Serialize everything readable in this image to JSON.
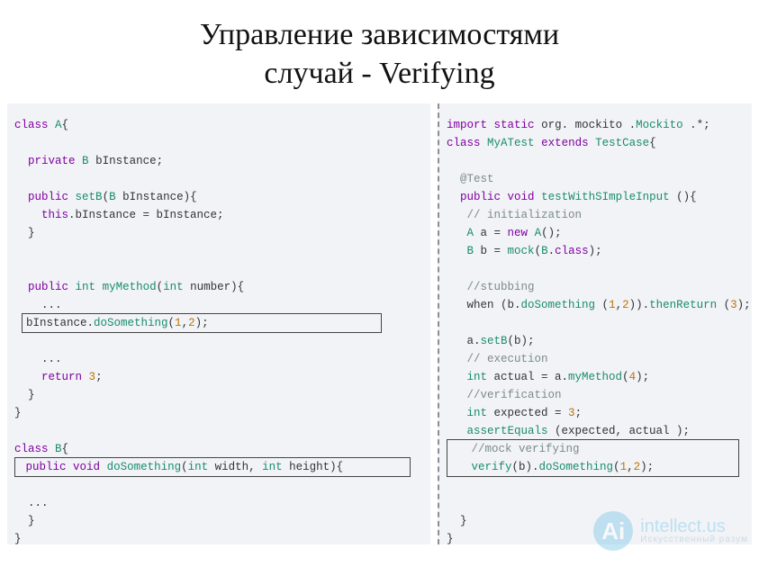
{
  "title_line1": "Управление зависимостями",
  "title_line2": "случай - Verifying",
  "left": {
    "l1_kw": "class",
    "l1_sp": " ",
    "l1_typ": "A",
    "l1_brace": "{",
    "l3_kw": "private",
    "l3_sp": " ",
    "l3_typ": "B",
    "l3_rest": " bInstance;",
    "l5_kw": "public",
    "l5_sp": " ",
    "l5_mth": "setB",
    "l5_open": "(",
    "l5_typ": "B",
    "l5_rest": " bInstance){",
    "l6_kw": "this",
    "l6_rest": ".bInstance = bInstance;",
    "l7": "}",
    "l10_kw": "public",
    "l10_sp": " ",
    "l10_typ": "int",
    "l10_sp2": " ",
    "l10_mth": "myMethod",
    "l10_open": "(",
    "l10_typ2": "int",
    "l10_rest": " number){",
    "l11": "...",
    "box1_a": "bInstance.",
    "box1_mth": "doSomething",
    "box1_open": "(",
    "box1_n1": "1",
    "box1_c": ",",
    "box1_n2": "2",
    "box1_close": ");",
    "l13": "...",
    "l14_kw": "return",
    "l14_sp": " ",
    "l14_n": "3",
    "l14_semi": ";",
    "l15": "}",
    "l16": "}",
    "l18_kw": "class",
    "l18_sp": " ",
    "l18_typ": "B",
    "l18_brace": "{",
    "box2_kw": "public",
    "box2_sp": " ",
    "box2_kw2": "void",
    "box2_sp2": " ",
    "box2_mth": "doSomething",
    "box2_open": "(",
    "box2_typ": "int",
    "box2_mid": " width, ",
    "box2_typ2": "int",
    "box2_rest": " height){",
    "l20": "...",
    "l21": "}",
    "l22": "}"
  },
  "right": {
    "r1_kw1": "import",
    "r1_sp1": " ",
    "r1_kw2": "static",
    "r1_sp2": " ",
    "r1_p": "org. mockito .",
    "r1_typ": "Mockito",
    "r1_rest": " .*;",
    "r2_kw": "class",
    "r2_sp": " ",
    "r2_typ": "MyATest",
    "r2_sp2": " ",
    "r2_kw2": "extends",
    "r2_sp3": " ",
    "r2_typ2": "TestCase",
    "r2_brace": "{",
    "r4_ann": "@Test",
    "r5_kw": "public",
    "r5_sp": " ",
    "r5_kw2": "void",
    "r5_sp2": " ",
    "r5_mth": "testWithSImpleInput",
    "r5_rest": " (){",
    "r6_cmt": "// initialization",
    "r7_typ": "A",
    "r7_mid": " a = ",
    "r7_kw": "new",
    "r7_sp": " ",
    "r7_typ2": "A",
    "r7_rest": "();",
    "r8_typ": "B",
    "r8_mid": " b = ",
    "r8_mth": "mock",
    "r8_open": "(",
    "r8_typ2": "B",
    "r8_dot": ".",
    "r8_kw": "class",
    "r8_close": ");",
    "r10_cmt": "//stubbing",
    "r11_a": "when (b.",
    "r11_mth": "doSomething",
    "r11_mid": " (",
    "r11_n1": "1",
    "r11_c": ",",
    "r11_n2": "2",
    "r11_close": ")).",
    "r11_mth2": "thenReturn",
    "r11_open2": " (",
    "r11_n3": "3",
    "r11_close2": ");",
    "r13_a": "a.",
    "r13_mth": "setB",
    "r13_rest": "(b);",
    "r14_cmt": "// execution",
    "r15_typ": "int",
    "r15_mid": " actual = a.",
    "r15_mth": "myMethod",
    "r15_open": "(",
    "r15_n": "4",
    "r15_close": ");",
    "r16_cmt": "//verification",
    "r17_typ": "int",
    "r17_mid": " expected = ",
    "r17_n": "3",
    "r17_semi": ";",
    "r18_mth": "assertEquals",
    "r18_rest": " (expected, actual );",
    "box_cmt": "//mock verifying",
    "box_mth": "verify",
    "box_open": "(b).",
    "box_mth2": "doSomething",
    "box_open2": "(",
    "box_n1": "1",
    "box_c": ",",
    "box_n2": "2",
    "box_close": ");",
    "r21": "}",
    "r22": "}"
  },
  "watermark": {
    "logo": "Ai",
    "text": "intellect.us",
    "sub": "Искусственный разум"
  }
}
